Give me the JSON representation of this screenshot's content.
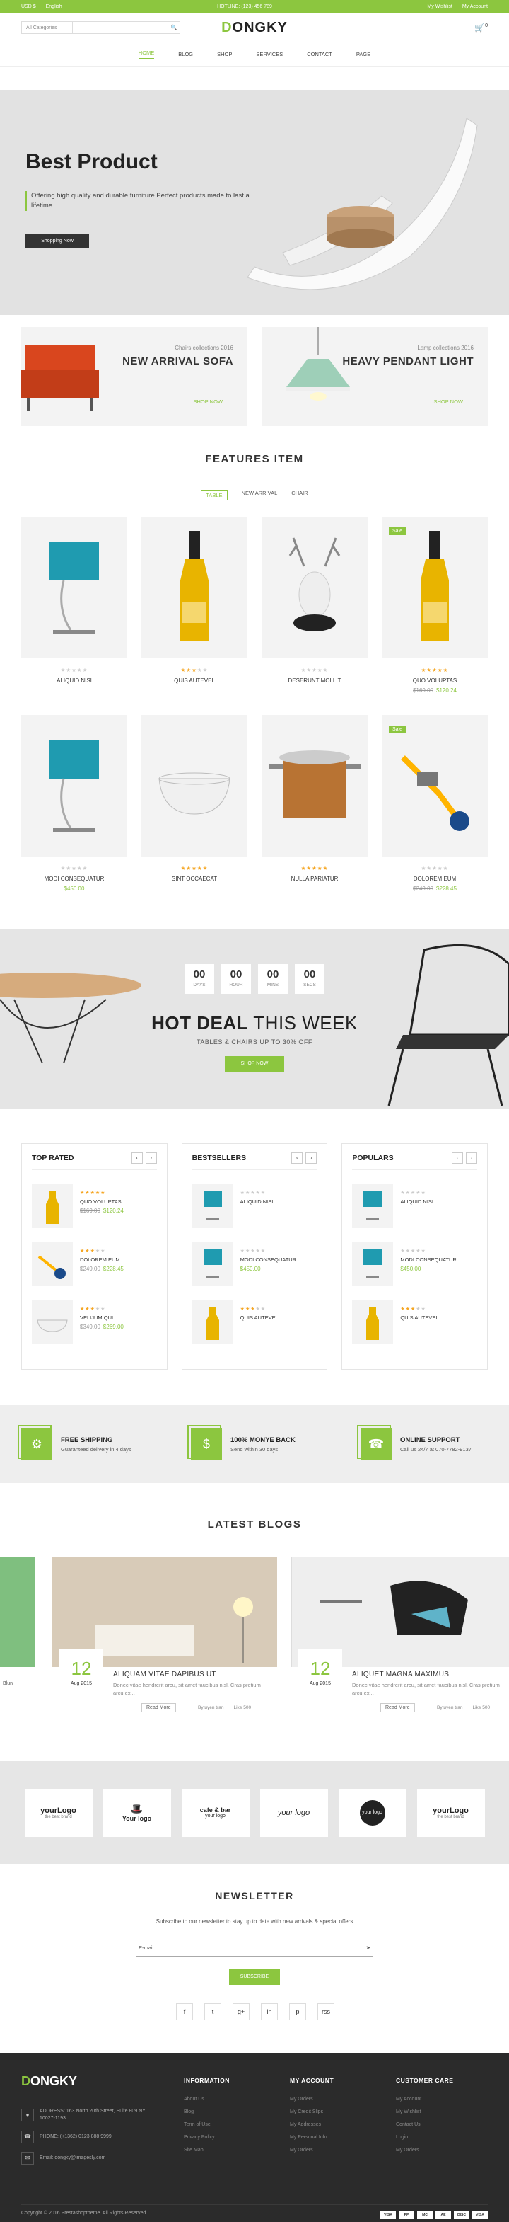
{
  "topbar": {
    "currency": "USD $",
    "language": "English",
    "phone": "HOTLINE: (123) 456 789",
    "wishlist": "My Wishlist",
    "account": "My Account"
  },
  "header": {
    "category": "All Categories",
    "search_placeholder": "",
    "logo_first": "D",
    "logo_rest": "ONGKY",
    "cart_count": "0"
  },
  "nav": [
    "HOME",
    "BLOG",
    "SHOP",
    "SERVICES",
    "CONTACT",
    "PAGE"
  ],
  "hero": {
    "title": "Best Product",
    "desc": "Offering high quality and durable furniture Perfect products made to last a lifetime",
    "button": "Shopping Now"
  },
  "banners": [
    {
      "sub": "Chairs collections 2016",
      "title": "NEW ARRIVAL SOFA",
      "link": "SHOP NOW"
    },
    {
      "sub": "Lamp collections 2016",
      "title": "HEAVY PENDANT LIGHT",
      "link": "SHOP NOW"
    }
  ],
  "features_title": "FEATURES ITEM",
  "tabs": [
    "TABLE",
    "NEW ARRIVAL",
    "CHAIR"
  ],
  "products": [
    {
      "name": "ALIQUID NISI",
      "price": "",
      "old": "",
      "sale": false,
      "rating": 0
    },
    {
      "name": "QUIS AUTEVEL",
      "price": "",
      "old": "",
      "sale": false,
      "rating": 3
    },
    {
      "name": "DESERUNT MOLLIT",
      "price": "",
      "old": "",
      "sale": false,
      "rating": 0
    },
    {
      "name": "QUO VOLUPTAS",
      "price": "$120.24",
      "old": "$169.00",
      "sale": true,
      "sale_label": "Sale",
      "rating": 5
    },
    {
      "name": "MODI CONSEQUATUR",
      "price": "$450.00",
      "old": "",
      "sale": false,
      "rating": 0
    },
    {
      "name": "SINT OCCAECAT",
      "price": "",
      "old": "",
      "sale": false,
      "rating": 5
    },
    {
      "name": "NULLA PARIATUR",
      "price": "",
      "old": "",
      "sale": false,
      "rating": 5
    },
    {
      "name": "DOLOREM EUM",
      "price": "$228.45",
      "old": "$249.00",
      "sale": true,
      "sale_label": "Sale",
      "rating": 0
    }
  ],
  "deal": {
    "countdown": [
      {
        "v": "00",
        "l": "DAYS"
      },
      {
        "v": "00",
        "l": "HOUR"
      },
      {
        "v": "00",
        "l": "MINS"
      },
      {
        "v": "00",
        "l": "SECS"
      }
    ],
    "title_bold": "HOT DEAL",
    "title_rest": " THIS WEEK",
    "sub": "TABLES & CHAIRS UP TO 30% OFF",
    "button": "SHOP NOW"
  },
  "lists": [
    {
      "title": "TOP RATED",
      "items": [
        {
          "name": "QUO VOLUPTAS",
          "price": "$120.24",
          "old": "$169.00",
          "rating": 5
        },
        {
          "name": "DOLOREM EUM",
          "price": "$228.45",
          "old": "$249.00",
          "rating": 3
        },
        {
          "name": "VELIJUM QUI",
          "price": "$269.00",
          "old": "$349.00",
          "rating": 3
        }
      ]
    },
    {
      "title": "BESTSELLERS",
      "items": [
        {
          "name": "ALIQUID NISI",
          "price": "",
          "old": "",
          "rating": 0
        },
        {
          "name": "MODI CONSEQUATUR",
          "price": "$450.00",
          "old": "",
          "rating": 0
        },
        {
          "name": "QUIS AUTEVEL",
          "price": "",
          "old": "",
          "rating": 3
        }
      ]
    },
    {
      "title": "POPULARS",
      "items": [
        {
          "name": "ALIQUID NISI",
          "price": "",
          "old": "",
          "rating": 0
        },
        {
          "name": "MODI CONSEQUATUR",
          "price": "$450.00",
          "old": "",
          "rating": 0
        },
        {
          "name": "QUIS AUTEVEL",
          "price": "",
          "old": "",
          "rating": 3
        }
      ]
    }
  ],
  "features": [
    {
      "title": "FREE SHIPPING",
      "sub": "Guaranteed delivery in 4 days",
      "icon": "bicycle-icon"
    },
    {
      "title": "100% MONYE BACK",
      "sub": "Send within 30 days",
      "icon": "dollar-icon"
    },
    {
      "title": "ONLINE SUPPORT",
      "sub": "Call us 24/7 at 070-7782-9137",
      "icon": "headset-icon"
    }
  ],
  "blogs_title": "LATEST BLOGS",
  "blogs": [
    {
      "day": "12",
      "month": "Aug 2015",
      "title": "ALIQUAM VITAE DAPIBUS UT",
      "desc": "Donec vitae hendrerit arcu, sit amet faucibus nisl. Cras pretium arcu ex...",
      "read": "Read More",
      "by": "Bytuyen tran",
      "likes": "Like 500"
    },
    {
      "day": "12",
      "month": "Aug 2015",
      "title": "ALIQUET MAGNA MAXIMUS",
      "desc": "Donec vitae hendrerit arcu, sit amet faucibus nisl. Cras pretium arcu ex...",
      "read": "Read More",
      "by": "Bytuyen tran",
      "likes": "Like 500"
    }
  ],
  "blog_side_left": "Blun",
  "brands": [
    {
      "a": "yourLogo",
      "b": "the best brand"
    },
    {
      "a": "Your logo",
      "b": ""
    },
    {
      "a": "cafe & bar",
      "b": "your logo"
    },
    {
      "a": "your logo",
      "b": ""
    },
    {
      "a": "your logo",
      "b": ""
    },
    {
      "a": "yourLogo",
      "b": "the best brand"
    }
  ],
  "newsletter": {
    "title": "NEWSLETTER",
    "desc": "Subscribe to our newsletter to stay up to date with new arrivals & special offers",
    "placeholder": "E-mail",
    "button": "SUBSCRIBE"
  },
  "social": [
    "f",
    "t",
    "g+",
    "in",
    "p",
    "rss"
  ],
  "footer": {
    "contact": [
      {
        "icon": "map-pin-icon",
        "text": "ADDRESS: 163 North 20th Street, Suite 809 NY 10027-1193"
      },
      {
        "icon": "phone-icon",
        "text": "PHONE: (+1362) 0123 888 9999"
      },
      {
        "icon": "mail-icon",
        "text": "Email: dongky@imagesly.com"
      }
    ],
    "cols": [
      {
        "title": "INFORMATION",
        "items": [
          "About Us",
          "Blog",
          "Term of Use",
          "Privacy Policy",
          "Site Map"
        ]
      },
      {
        "title": "MY ACCOUNT",
        "items": [
          "My Orders",
          "My Credit Slips",
          "My Addresses",
          "My Personal Info",
          "My Orders"
        ]
      },
      {
        "title": "CUSTOMER CARE",
        "items": [
          "My Account",
          "My Wishlist",
          "Contact Us",
          "Login",
          "My Orders"
        ]
      }
    ],
    "copyright": "Copyright © 2016 Prestashoptheme. All Rights Reserved",
    "cards": [
      "VISA",
      "PP",
      "MC",
      "AE",
      "DISC",
      "VISA"
    ]
  }
}
